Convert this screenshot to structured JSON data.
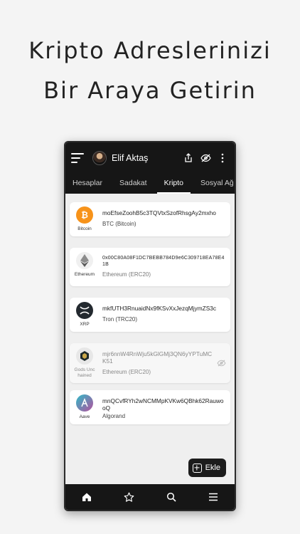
{
  "headline": {
    "line1": "Kripto Adreslerinizi",
    "line2": "Bir Araya Getirin"
  },
  "topbar": {
    "user_name": "Elif Aktaş"
  },
  "tabs": [
    {
      "label": "Hesaplar"
    },
    {
      "label": "Sadakat"
    },
    {
      "label": "Kripto"
    },
    {
      "label": "Sosyal Ağ"
    }
  ],
  "active_tab": "Kripto",
  "wallets": [
    {
      "coin": "Bitcoin",
      "address": "moEfseZoohB5c3TQVtxSzofRhsgAy2mxho",
      "network": "BTC (Bitcoin)",
      "icon": "bitcoin-icon",
      "color": "#F7931A",
      "hidden": false
    },
    {
      "coin": "Ethereum",
      "address": "0x00C80A08F1DC7BEBB784D9e6C309718EA78E41B",
      "network": "Ethereum (ERC20)",
      "icon": "ethereum-icon",
      "color": "#8C8C8C",
      "hidden": false
    },
    {
      "coin": "XRP",
      "address": "mkfUTH3RnuaidNx9fKSvXxJezqMjymZS3c",
      "network": "Tron (TRC20)",
      "icon": "xrp-icon",
      "color": "#23292F",
      "hidden": false
    },
    {
      "coin": "Gods Unchained",
      "address": "mjr6nnW4RnWju5kGlGMj3QN6yYPTuMCK51",
      "network": "Ethereum (ERC20)",
      "icon": "gods-unchained-icon",
      "color": "#1E2A2A",
      "hidden": true
    },
    {
      "coin": "Aave",
      "address": "mnQCvfRYh2wNCMMpKVKw6QBhk62RauwooQ",
      "network": "Algorand",
      "icon": "aave-icon",
      "color": "#B6509E",
      "hidden": false
    }
  ],
  "fab": {
    "label": "Ekle"
  },
  "bottom_nav": [
    {
      "icon": "home-icon"
    },
    {
      "icon": "star-icon"
    },
    {
      "icon": "search-icon"
    },
    {
      "icon": "menu-icon"
    }
  ],
  "colors": {
    "bar": "#161616",
    "screen_bg": "#efefef",
    "card_bg": "#ffffff"
  }
}
